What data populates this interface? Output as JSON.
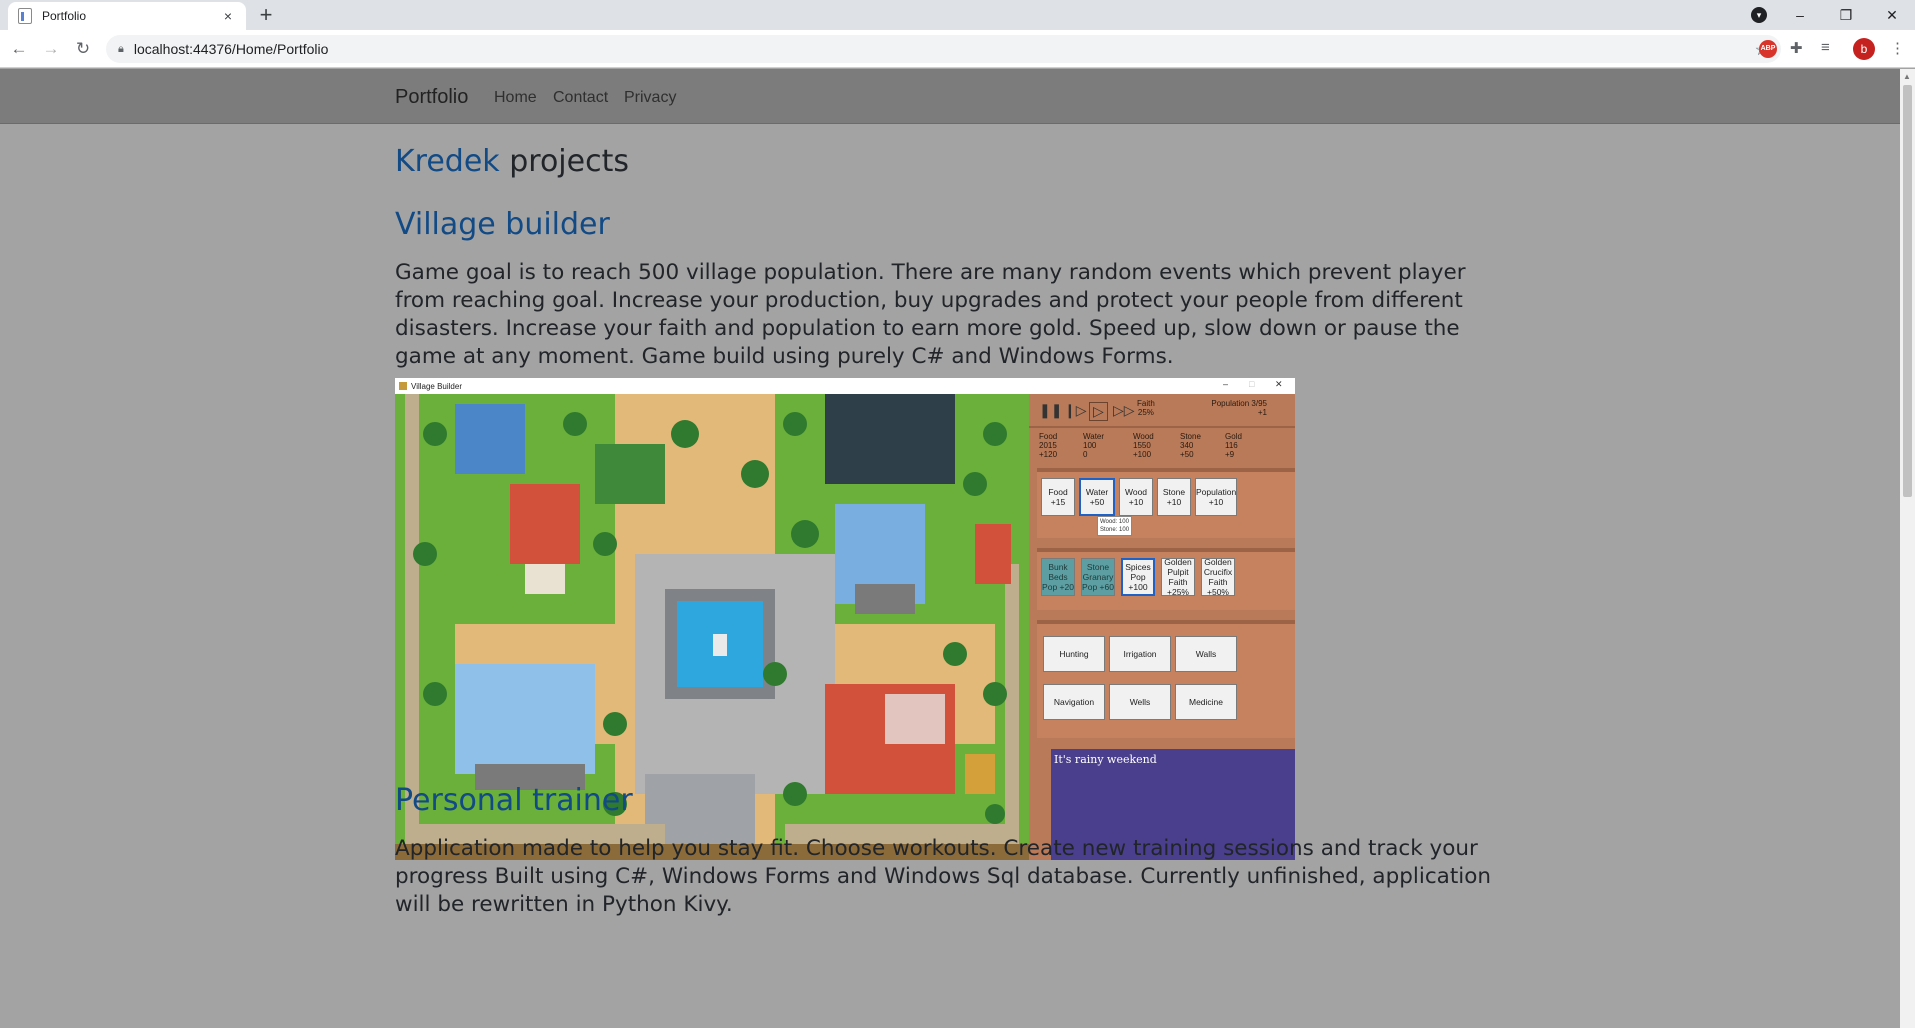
{
  "browser": {
    "tab_title": "Portfolio",
    "tab_close": "×",
    "new_tab": "+",
    "url": "localhost:44376/Home/Portfolio",
    "profile_initial": "b",
    "abp": "ABP",
    "win_minimize": "–",
    "win_restore": "❐",
    "win_close": "✕",
    "menu": "⋮"
  },
  "navbar": {
    "brand": "Portfolio",
    "links": [
      "Home",
      "Contact",
      "Privacy"
    ]
  },
  "page": {
    "heading_accent": "Kredek",
    "heading_rest": " projects",
    "projects": [
      {
        "title": "Village builder",
        "description": "Game goal is to reach 500 village population. There are many random events which prevent player from reaching goal. Increase your production, buy upgrades and protect your people from different disasters. Increase your faith and population to earn more gold. Speed up, slow down or pause the game at any moment. Game build using purely C# and Windows Forms."
      },
      {
        "title": "Personal trainer",
        "description": "Application made to help you stay fit. Choose workouts. Create new training sessions and track your progress Built using C#, Windows Forms and Windows Sql database. Currently unfinished, application will be rewritten in Python Kivy."
      }
    ]
  },
  "game": {
    "window_title": "Village Builder",
    "faith_label": "Faith",
    "faith_value": "25%",
    "population_label": "Population 3/95",
    "population_delta": "+1",
    "resources": [
      {
        "name": "Food",
        "amount": "2015",
        "delta": "+120"
      },
      {
        "name": "Water",
        "amount": "100",
        "delta": "0"
      },
      {
        "name": "Wood",
        "amount": "1550",
        "delta": "+100"
      },
      {
        "name": "Stone",
        "amount": "340",
        "delta": "+50"
      },
      {
        "name": "Gold",
        "amount": "116",
        "delta": "+9"
      }
    ],
    "production_buttons": [
      {
        "name": "Food",
        "value": "+15"
      },
      {
        "name": "Water",
        "value": "+50"
      },
      {
        "name": "Wood",
        "value": "+10"
      },
      {
        "name": "Stone",
        "value": "+10"
      },
      {
        "name": "Population",
        "value": "+10"
      }
    ],
    "tooltip_line1": "Wood: 100",
    "tooltip_line2": "Stone: 100",
    "upgrade_buttons": [
      {
        "name": "Bunk Beds",
        "value": "Pop +20"
      },
      {
        "name": "Stone Granary",
        "value": "Pop +60"
      },
      {
        "name": "Spices",
        "value": "Pop +100"
      },
      {
        "name": "Golden Pulpit",
        "value": "Faith +25%"
      },
      {
        "name": "Golden Crucifix",
        "value": "Faith +50%"
      }
    ],
    "tech_buttons": [
      "Hunting",
      "Irrigation",
      "Walls",
      "Navigation",
      "Wells",
      "Medicine"
    ],
    "event_text": "It's rainy weekend"
  },
  "colors": {
    "accent": "#124a86",
    "navbar": "#7c7c7c",
    "page_bg": "#a3a3a3",
    "event_bg": "#4a3f8c"
  }
}
